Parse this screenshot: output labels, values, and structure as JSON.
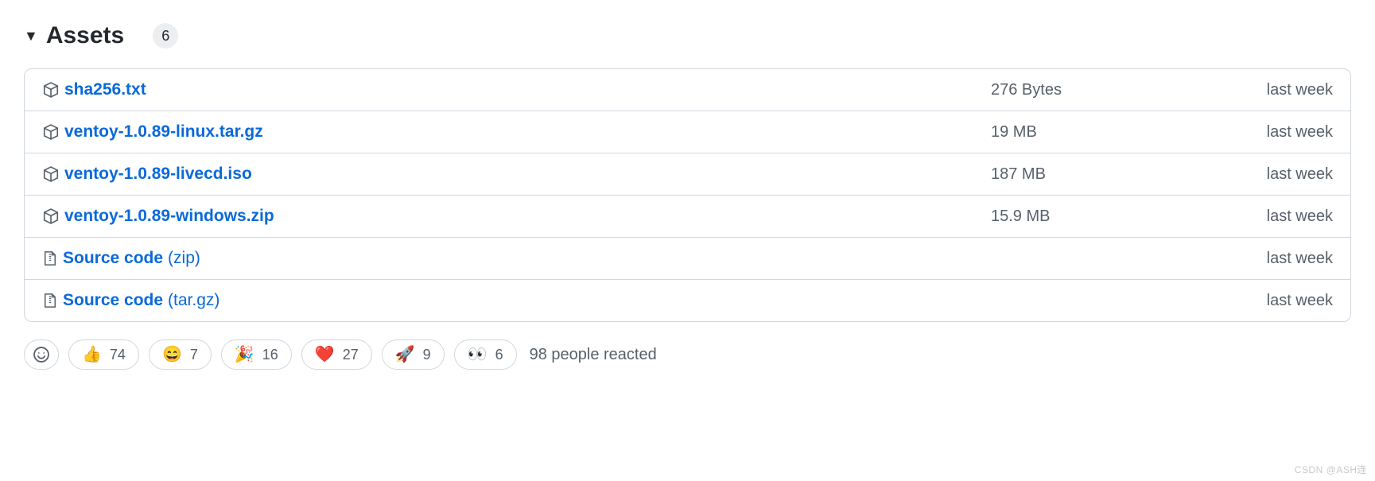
{
  "header": {
    "title": "Assets",
    "count": "6"
  },
  "assets": [
    {
      "name": "sha256.txt",
      "ext": "",
      "size": "276 Bytes",
      "date": "last week",
      "icon": "package"
    },
    {
      "name": "ventoy-1.0.89-linux.tar.gz",
      "ext": "",
      "size": "19 MB",
      "date": "last week",
      "icon": "package"
    },
    {
      "name": "ventoy-1.0.89-livecd.iso",
      "ext": "",
      "size": "187 MB",
      "date": "last week",
      "icon": "package"
    },
    {
      "name": "ventoy-1.0.89-windows.zip",
      "ext": "",
      "size": "15.9 MB",
      "date": "last week",
      "icon": "package"
    },
    {
      "name": "Source code",
      "ext": "(zip)",
      "size": "",
      "date": "last week",
      "icon": "zip"
    },
    {
      "name": "Source code",
      "ext": "(tar.gz)",
      "size": "",
      "date": "last week",
      "icon": "zip"
    }
  ],
  "reactions": [
    {
      "emoji": "👍",
      "count": "74"
    },
    {
      "emoji": "😄",
      "count": "7"
    },
    {
      "emoji": "🎉",
      "count": "16"
    },
    {
      "emoji": "❤️",
      "count": "27"
    },
    {
      "emoji": "🚀",
      "count": "9"
    },
    {
      "emoji": "👀",
      "count": "6"
    }
  ],
  "reaction_summary": "98 people reacted",
  "watermark": "CSDN @ASH连"
}
